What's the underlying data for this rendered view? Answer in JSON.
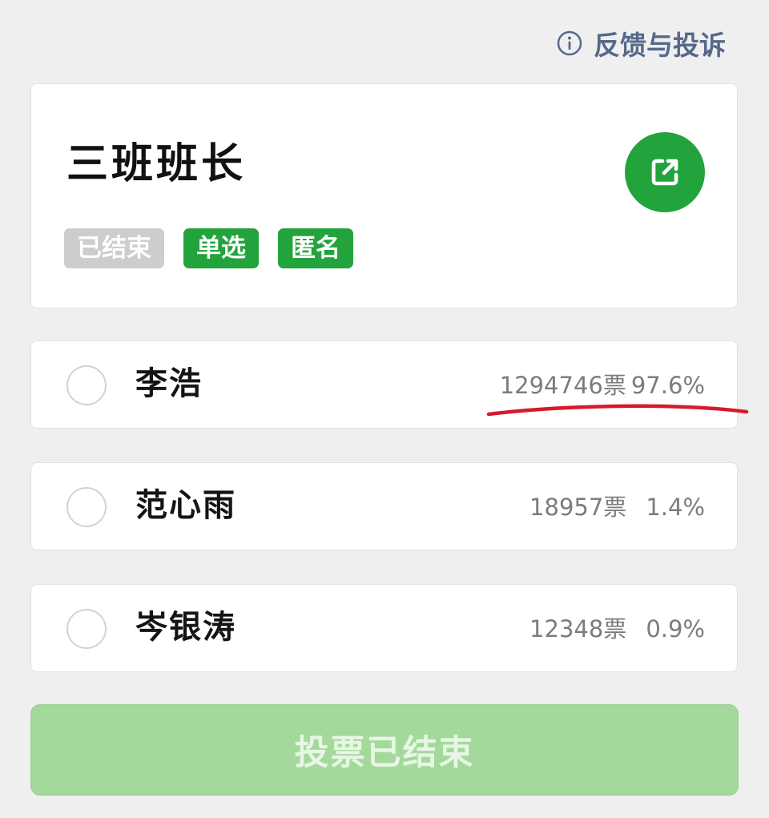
{
  "header": {
    "feedback_label": "反馈与投诉",
    "feedback_icon": "info-circle-icon"
  },
  "poll": {
    "title": "三班班长",
    "share_icon": "share-external-icon",
    "tags": [
      "已结束",
      "单选",
      "匿名"
    ]
  },
  "options": [
    {
      "name": "李浩",
      "votes": "1294746票",
      "percent": "97.6%"
    },
    {
      "name": "范心雨",
      "votes": "18957票",
      "percent": "1.4%"
    },
    {
      "name": "岑银涛",
      "votes": "12348票",
      "percent": "0.9%"
    }
  ],
  "vote_button": {
    "label": "投票已结束",
    "enabled": false
  },
  "annotation": {
    "type": "red-hand-drawn-underline",
    "target": "options.0"
  },
  "colors": {
    "background": "#efefef",
    "accent_green": "#22a33c",
    "tag_ended": "#cdcdcd",
    "disabled_button": "#a3d99a",
    "link_blue_gray": "#56698a",
    "stat_gray": "#7c7c7c",
    "annotation_red": "#d8192b"
  }
}
